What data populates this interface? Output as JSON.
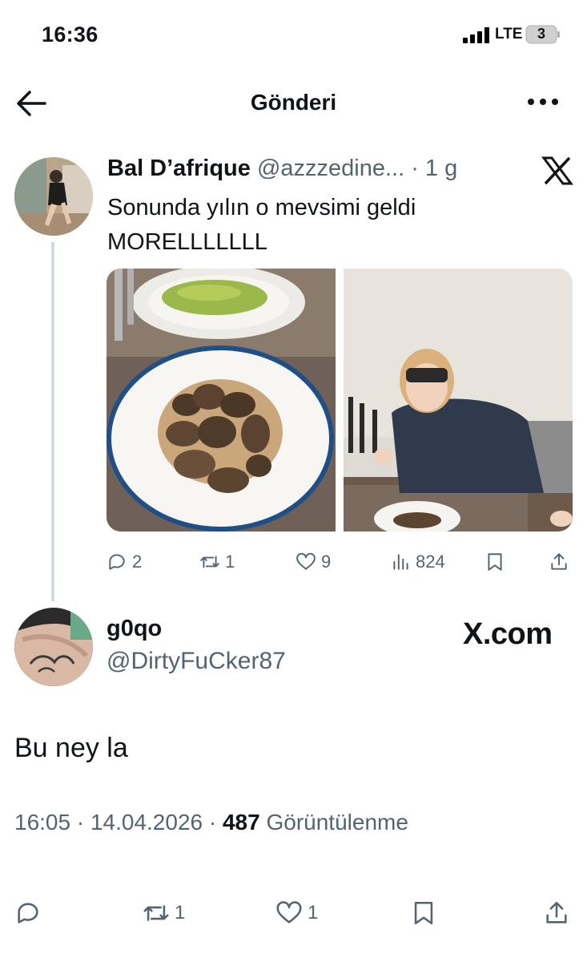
{
  "status_bar": {
    "time": "16:36",
    "network": "LTE",
    "battery": "3"
  },
  "header": {
    "title": "Gönderi"
  },
  "quoted_tweet": {
    "name": "Bal D’afrique",
    "handle_time": "@azzzedine... · 1 g",
    "text_line1": "Sonunda yılın o mevsimi geldi",
    "text_line2": "MORELLLLLLL",
    "replies": "2",
    "retweets": "1",
    "likes": "9",
    "views": "824"
  },
  "reply": {
    "name": "g0qo",
    "handle": "@DirtyFuCker87",
    "watermark": "X.com",
    "text": "Bu ney la",
    "time_date": "16:05 · 14.04.2026 · ",
    "views_count": "487",
    "views_label": " Görüntülenme",
    "retweets": "1",
    "likes": "1"
  },
  "icons": [
    "back-arrow-icon",
    "more-icon",
    "x-logo-icon",
    "reply-icon",
    "retweet-icon",
    "like-icon",
    "views-icon",
    "bookmark-icon",
    "share-icon"
  ],
  "colors": {
    "text": "#0f1419",
    "secondary": "#536471",
    "line": "#cfd9de"
  }
}
